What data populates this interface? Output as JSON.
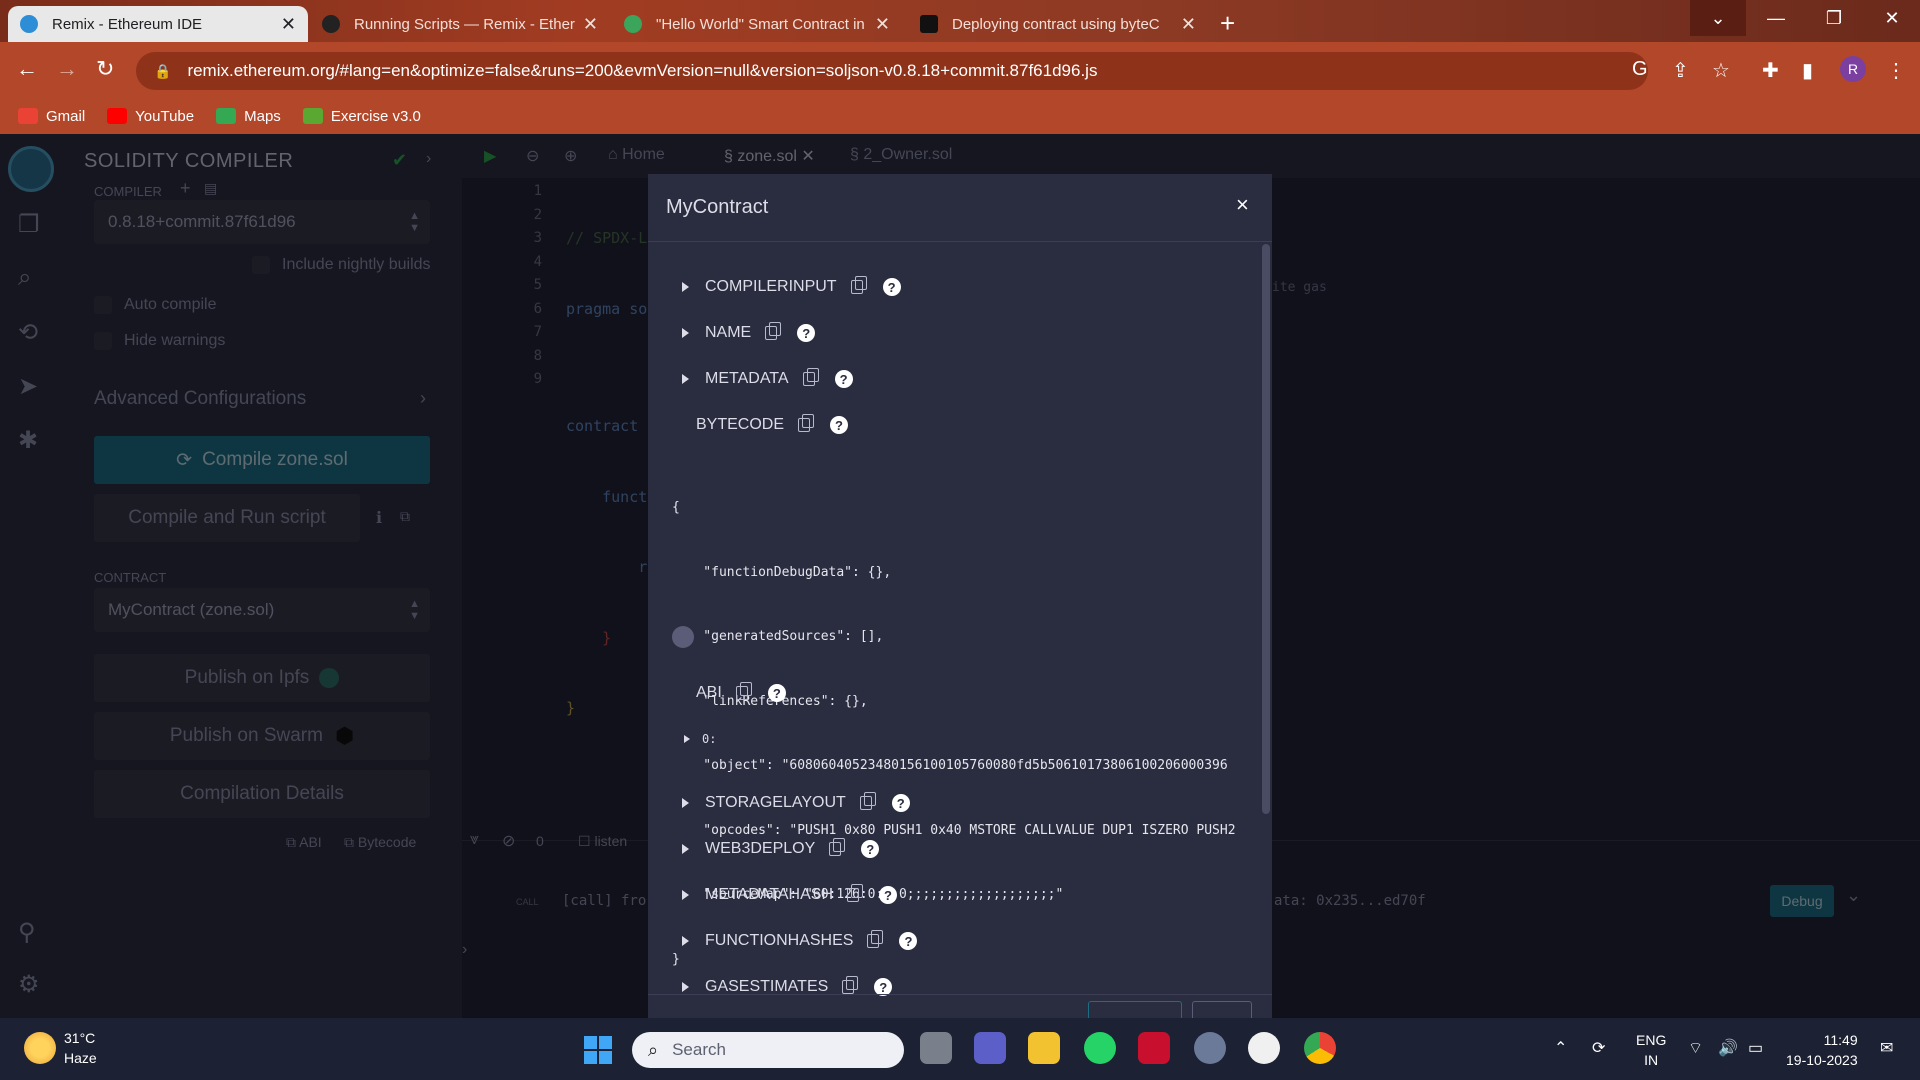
{
  "browser": {
    "tabs": [
      {
        "title": "Remix - Ethereum IDE",
        "active": true,
        "favicon_color": "#2d8dd6"
      },
      {
        "title": "Running Scripts — Remix - Ether",
        "active": false,
        "favicon_color": "#222222"
      },
      {
        "title": "\"Hello World\" Smart Contract in",
        "active": false,
        "favicon_color": "#3ba55c"
      },
      {
        "title": "Deploying contract using byteC",
        "active": false,
        "favicon_color": "#111111"
      }
    ],
    "url": "remix.ethereum.org/#lang=en&optimize=false&runs=200&evmVersion=null&version=soljson-v0.8.18+commit.87f61d96.js",
    "profile_initial": "R",
    "bookmarks": [
      {
        "label": "Gmail",
        "color": "#ea4335"
      },
      {
        "label": "YouTube",
        "color": "#ff0000"
      },
      {
        "label": "Maps",
        "color": "#34a853"
      },
      {
        "label": "Exercise v3.0",
        "color": "#5aa832"
      }
    ],
    "accent": "#b3472a"
  },
  "compiler_panel": {
    "title": "SOLIDITY COMPILER",
    "compiler_label": "COMPILER",
    "version": "0.8.18+commit.87f61d96",
    "include_nightly": "Include nightly builds",
    "auto_compile": "Auto compile",
    "hide_warnings": "Hide warnings",
    "advanced": "Advanced Configurations",
    "compile_button": "Compile zone.sol",
    "compile_run_button": "Compile and Run script",
    "contract_label": "CONTRACT",
    "contract_value": "MyContract (zone.sol)",
    "publish_ipfs": "Publish on Ipfs",
    "publish_swarm": "Publish on Swarm",
    "compilation_details": "Compilation Details",
    "abi_link": "ABI",
    "bytecode_link": "Bytecode"
  },
  "editor": {
    "tabs": [
      "Home",
      "zone.sol",
      "2_Owner.sol"
    ],
    "line_numbers": [
      "1",
      "2",
      "3",
      "4",
      "5",
      "6",
      "7",
      "8",
      "9"
    ],
    "code_lines": [
      "// SPDX-L",
      "pragma so",
      "",
      "contract",
      "    funct",
      "        r",
      "    }",
      "}",
      ""
    ],
    "hint_text": "ite gas",
    "terminal_count": "0",
    "terminal_listen": "listen",
    "terminal_call_tag": "CALL",
    "terminal_call": "[call] fro",
    "terminal_data": "ata: 0x235...ed70f",
    "debug_button": "Debug"
  },
  "modal": {
    "title": "MyContract",
    "close": "×",
    "sections_top": [
      {
        "label": "COMPILERINPUT",
        "expanded": false
      },
      {
        "label": "NAME",
        "expanded": false
      },
      {
        "label": "METADATA",
        "expanded": false
      },
      {
        "label": "BYTECODE",
        "expanded": true
      }
    ],
    "bytecode_json": [
      "{",
      "    \"functionDebugData\": {},",
      "    \"generatedSources\": [],",
      "    \"linkReferences\": {},",
      "    \"object\": \"60806040523480156100105760080fd5b50610173806100206000396",
      "    \"opcodes\": \"PUSH1 0x80 PUSH1 0x40 MSTORE CALLVALUE DUP1 ISZERO PUSH2",
      "    \"sourceMap\": \"60:126:0:-:0;;;;;;;;;;;;;;;;;;;\"",
      "}"
    ],
    "abi_label": "ABI",
    "abi_item": "0:",
    "sections_bottom": [
      {
        "label": "STORAGELAYOUT"
      },
      {
        "label": "WEB3DEPLOY"
      },
      {
        "label": "METADATAHASH"
      },
      {
        "label": "FUNCTIONHASHES"
      },
      {
        "label": "GASESTIMATES"
      }
    ],
    "help_glyph": "?"
  },
  "taskbar": {
    "temperature": "31°C",
    "weather": "Haze",
    "search_placeholder": "Search",
    "language": "ENG",
    "region": "IN",
    "time": "11:49",
    "date": "19-10-2023"
  }
}
